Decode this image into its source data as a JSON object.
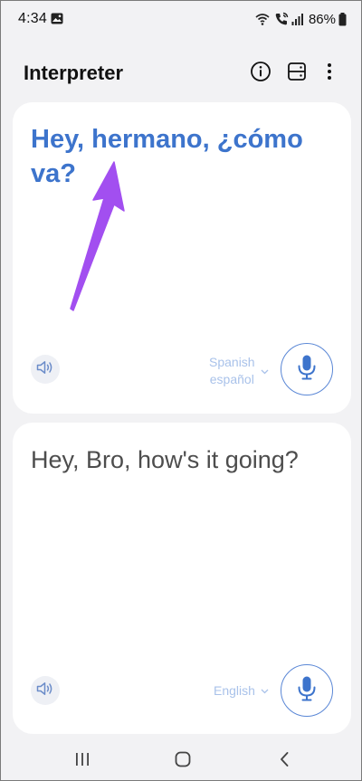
{
  "status_bar": {
    "time": "4:34",
    "battery": "86%"
  },
  "app_bar": {
    "title": "Interpreter",
    "icons": [
      "info-icon",
      "split-layout-icon",
      "more-vert-icon"
    ]
  },
  "source_panel": {
    "text": "Hey, hermano, ¿cómo va?",
    "language_name": "Spanish",
    "language_native": "español",
    "accent_color": "#3d74cc"
  },
  "target_panel": {
    "text": "Hey, Bro, how's it going?",
    "language_name": "English"
  },
  "annotation": {
    "color": "#a24ff0",
    "icon": "annotation-arrow"
  },
  "nav_bar": {
    "icons": [
      "recents-icon",
      "home-icon",
      "back-icon"
    ]
  }
}
